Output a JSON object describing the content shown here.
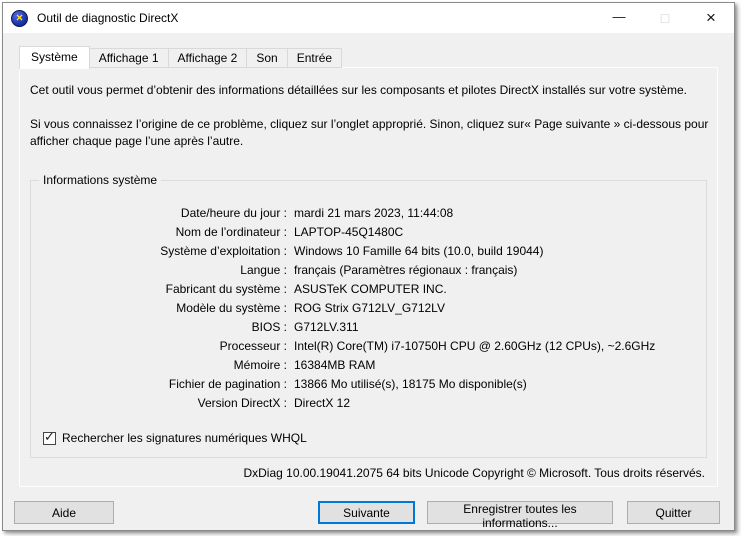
{
  "window": {
    "title": "Outil de diagnostic DirectX",
    "icon_glyph": "×",
    "controls": {
      "minimize": "—",
      "maximize": "□",
      "close": "×"
    }
  },
  "tabs": [
    {
      "label": "Système",
      "active": true
    },
    {
      "label": "Affichage 1",
      "active": false
    },
    {
      "label": "Affichage 2",
      "active": false
    },
    {
      "label": "Son",
      "active": false
    },
    {
      "label": "Entrée",
      "active": false
    }
  ],
  "intro": {
    "paragraph1": "Cet outil vous permet d’obtenir des informations détaillées sur les composants et pilotes DirectX installés sur votre système.",
    "paragraph2": "Si vous connaissez l’origine de ce problème, cliquez sur l’onglet approprié. Sinon, cliquez sur« Page suivante » ci-dessous pour afficher chaque page l’une après l’autre."
  },
  "system_info": {
    "group_title": "Informations système",
    "rows": [
      {
        "label": "Date/heure du jour :",
        "value": "mardi 21 mars 2023, 11:44:08"
      },
      {
        "label": "Nom de l’ordinateur :",
        "value": "LAPTOP-45Q1480C"
      },
      {
        "label": "Système d’exploitation :",
        "value": "Windows 10 Famille 64 bits (10.0, build 19044)"
      },
      {
        "label": "Langue :",
        "value": "français (Paramètres régionaux : français)"
      },
      {
        "label": "Fabricant du système :",
        "value": "ASUSTeK COMPUTER INC."
      },
      {
        "label": "Modèle du système :",
        "value": "ROG Strix G712LV_G712LV"
      },
      {
        "label": "BIOS :",
        "value": "G712LV.311"
      },
      {
        "label": "Processeur :",
        "value": "Intel(R) Core(TM) i7-10750H CPU @ 2.60GHz (12 CPUs), ~2.6GHz"
      },
      {
        "label": "Mémoire :",
        "value": "16384MB RAM"
      },
      {
        "label": "Fichier de pagination :",
        "value": "13866 Mo utilisé(s), 18175 Mo disponible(s)"
      },
      {
        "label": "Version DirectX :",
        "value": "DirectX 12"
      }
    ],
    "whql_checkbox": {
      "label": "Rechercher les signatures numériques WHQL",
      "checked": true,
      "check_glyph": "✓"
    }
  },
  "footer_note": "DxDiag 10.00.19041.2075 64 bits Unicode Copyright © Microsoft. Tous droits réservés.",
  "buttons": {
    "help": "Aide",
    "next": "Suivante",
    "save": "Enregistrer toutes les informations...",
    "quit": "Quitter"
  },
  "colors": {
    "accent_blue": "#0078d7",
    "window_bg": "#f0f0f0",
    "titlebar_bg": "#ffffff",
    "button_bg": "#e1e1e1",
    "button_border": "#adadad",
    "icon_sphere_blue": "#2038b0",
    "icon_x_yellow": "#ffe230"
  }
}
